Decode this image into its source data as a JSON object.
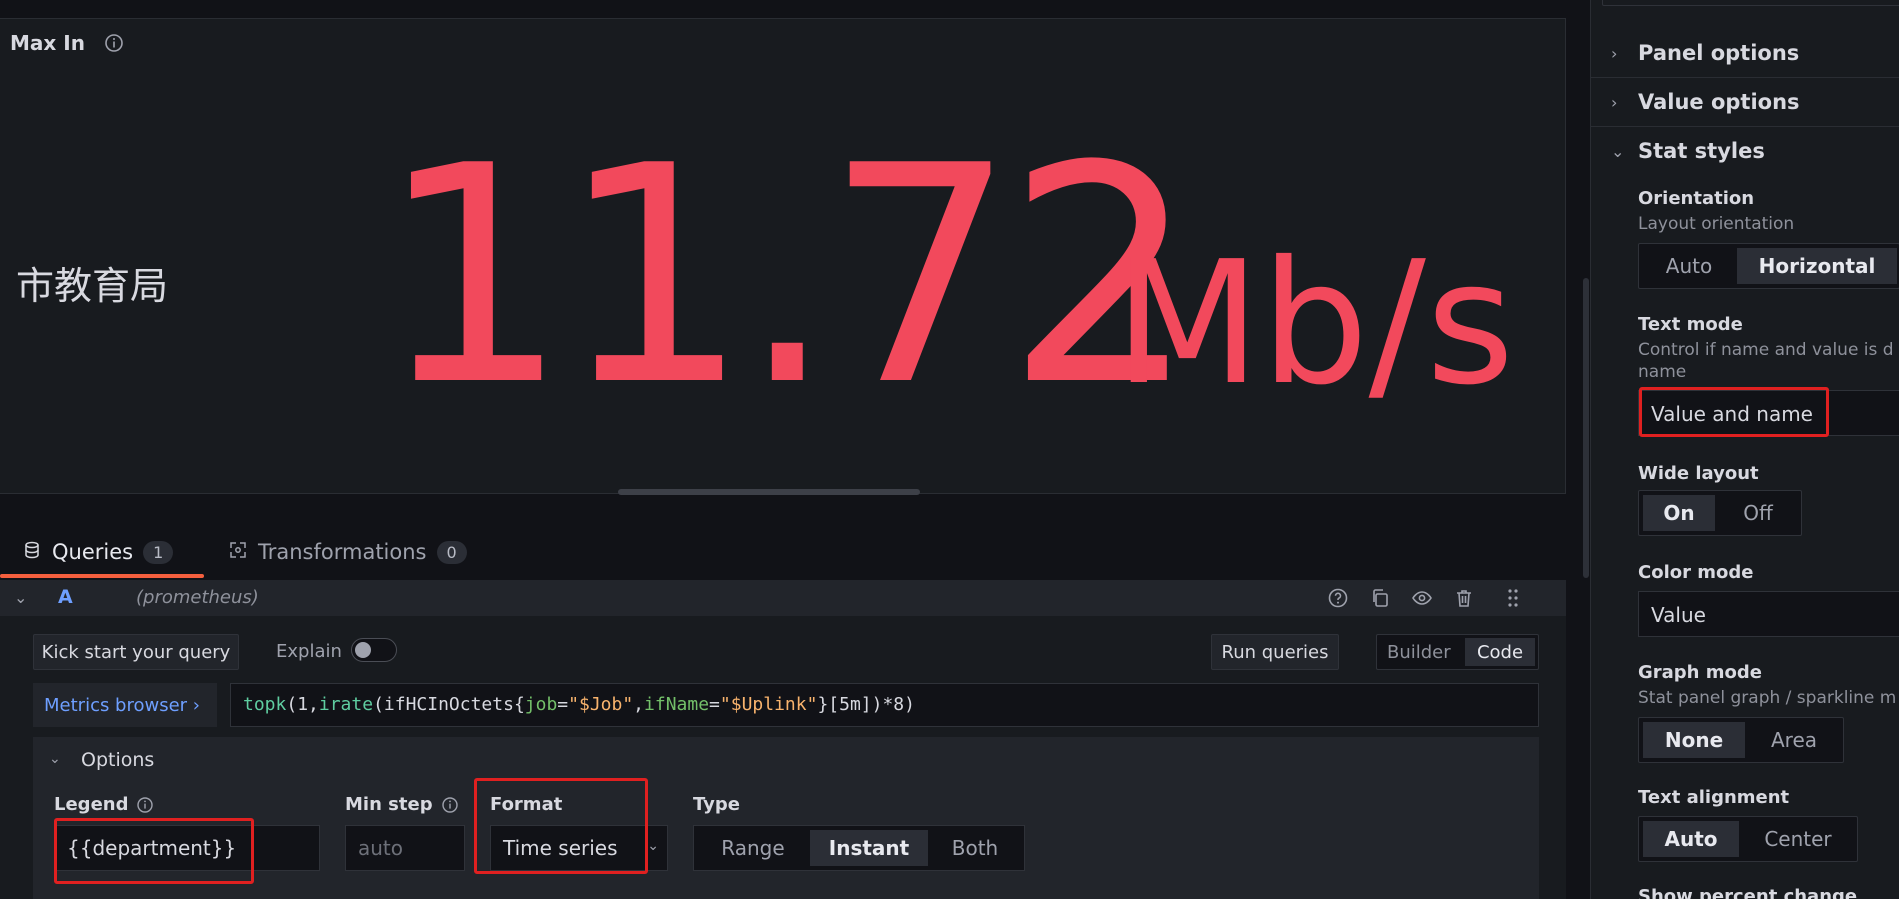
{
  "panel": {
    "title": "Max In",
    "stat_name": "市教育局",
    "stat_value": "11.72",
    "stat_unit": "Mb/s",
    "value_color": "#f2495c"
  },
  "tabs": [
    {
      "label": "Queries",
      "count": "1"
    },
    {
      "label": "Transformations",
      "count": "0"
    }
  ],
  "query": {
    "ref_id": "A",
    "datasource": "(prometheus)",
    "kick_start_label": "Kick start your query",
    "explain_label": "Explain",
    "run_queries_label": "Run queries",
    "mode_builder": "Builder",
    "mode_code": "Code",
    "metrics_browser_label": "Metrics browser ›",
    "expr_parts": {
      "p1": "topk",
      "p2": "(1,",
      "p3": "irate",
      "p4": "(ifHCInOctets{",
      "p5": "job",
      "p6": "=",
      "p7": "\"$Job\"",
      "p8": ",",
      "p9": "ifName",
      "p10": "=",
      "p11": "\"$Uplink\"",
      "p12": "}[5m])*8)"
    },
    "options": {
      "title": "Options",
      "legend_label": "Legend",
      "legend_value": "{{department}}",
      "min_step_label": "Min step",
      "min_step_placeholder": "auto",
      "format_label": "Format",
      "format_value": "Time series",
      "type_label": "Type",
      "type_options": [
        "Range",
        "Instant",
        "Both"
      ],
      "type_selected": "Instant"
    }
  },
  "sidebar": {
    "sections": [
      "Panel options",
      "Value options",
      "Stat styles"
    ],
    "orientation": {
      "label": "Orientation",
      "desc": "Layout orientation",
      "options": [
        "Auto",
        "Horizontal"
      ],
      "selected": "Horizontal"
    },
    "text_mode": {
      "label": "Text mode",
      "desc_line1": "Control if name and value is d",
      "desc_line2": "name",
      "value": "Value and name"
    },
    "wide_layout": {
      "label": "Wide layout",
      "options": [
        "On",
        "Off"
      ],
      "selected": "On"
    },
    "color_mode": {
      "label": "Color mode",
      "value": "Value"
    },
    "graph_mode": {
      "label": "Graph mode",
      "desc": "Stat panel graph / sparkline m",
      "options": [
        "None",
        "Area"
      ],
      "selected": "None"
    },
    "text_alignment": {
      "label": "Text alignment",
      "options": [
        "Auto",
        "Center"
      ],
      "selected": "Auto"
    },
    "show_percent_change": {
      "label": "Show percent change"
    }
  },
  "colors": {
    "accent_blue": "#6e9fff",
    "tab_underline": "#f55f3e",
    "highlight": "#e02020"
  }
}
